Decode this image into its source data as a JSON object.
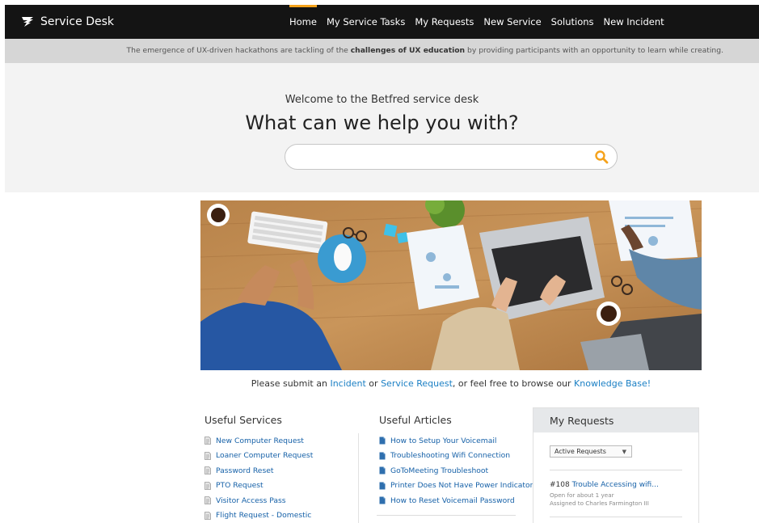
{
  "header": {
    "brand": "Service Desk",
    "nav": [
      "Home",
      "My Service Tasks",
      "My Requests",
      "New Service",
      "Solutions",
      "New Incident"
    ]
  },
  "ticker": {
    "prefix": "The emergence of UX-driven hackathons are tackling of the ",
    "bold": "challenges of UX education",
    "suffix": " by providing participants with an opportunity to learn while creating."
  },
  "hero": {
    "welcome": "Welcome to the Betfred service desk",
    "headline": "What can we help you with?",
    "search_value": ""
  },
  "prompt": {
    "p1": "Please submit an ",
    "incident": "Incident",
    "p2": " or ",
    "service_request": "Service Request",
    "p3": ", or feel free to browse our ",
    "knowledge_base": "Knowledge Base!"
  },
  "services": {
    "title": "Useful Services",
    "items": [
      "New Computer Request",
      "Loaner Computer Request",
      "Password Reset",
      "PTO Request",
      "Visitor Access Pass",
      "Flight Request - Domestic"
    ]
  },
  "articles": {
    "title": "Useful Articles",
    "items": [
      "How to Setup Your Voicemail",
      "Troubleshooting Wifi Connection",
      "GoToMeeting Troubleshoot",
      "Printer Does Not Have Power Indicator",
      "How to Reset Voicemail Password"
    ]
  },
  "requests": {
    "title": "My Requests",
    "filter": "Active Requests",
    "item": {
      "number": "#108",
      "title": "Trouble Accessing wifi...",
      "open_for": "Open for about 1 year",
      "assigned": "Assigned to Charles Farmington III"
    }
  },
  "colors": {
    "accent": "#f5a21b",
    "link": "#1a7fc4",
    "topbar": "#141414"
  }
}
